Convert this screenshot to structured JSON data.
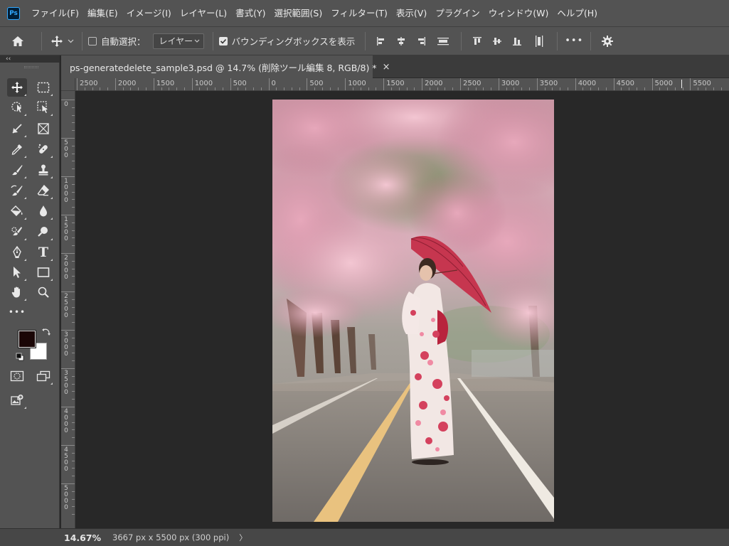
{
  "app": {
    "logo_text": "Ps",
    "menus": [
      "ファイル(F)",
      "編集(E)",
      "イメージ(I)",
      "レイヤー(L)",
      "書式(Y)",
      "選択範囲(S)",
      "フィルター(T)",
      "表示(V)",
      "プラグイン",
      "ウィンドウ(W)",
      "ヘルプ(H)"
    ]
  },
  "options": {
    "auto_select_label": "自動選択：",
    "auto_select_checked": false,
    "layer_select_value": "レイヤー",
    "bounding_box_label": "バウンディングボックスを表示",
    "bounding_box_checked": true,
    "more_label": "•••"
  },
  "panel": {
    "collapse_label": "‹‹"
  },
  "document": {
    "tab_title": "ps-generatedelete_sample3.psd @ 14.7% (削除ツール編集 8, RGB/8) *",
    "close_glyph": "×"
  },
  "rulers": {
    "horizontal_labels": [
      "2500",
      "2000",
      "1500",
      "1000",
      "500",
      "0",
      "500",
      "1000",
      "1500",
      "2000",
      "2500",
      "3000",
      "3500",
      "4000",
      "4500",
      "5000",
      "5500"
    ],
    "vertical_labels": [
      "0",
      "500",
      "1000",
      "1500",
      "2000",
      "2500",
      "3000",
      "3500",
      "4000",
      "4500",
      "5000"
    ]
  },
  "tools": [
    {
      "name": "move-tool",
      "icon": "move-icon",
      "active": true
    },
    {
      "name": "rectangular-marquee-tool",
      "icon": "marquee-icon"
    },
    {
      "name": "object-selection-tool",
      "icon": "object-selection-icon"
    },
    {
      "name": "select-subject-tool",
      "icon": "select-subject-icon"
    },
    {
      "name": "crop-tool",
      "icon": "crop-icon"
    },
    {
      "name": "frame-tool",
      "icon": "frame-icon"
    },
    {
      "name": "eyedropper-tool",
      "icon": "eyedropper-icon"
    },
    {
      "name": "healing-brush-tool",
      "icon": "bandage-icon"
    },
    {
      "name": "brush-tool",
      "icon": "brush-icon"
    },
    {
      "name": "clone-stamp-tool",
      "icon": "stamp-icon"
    },
    {
      "name": "history-brush-tool",
      "icon": "history-brush-icon"
    },
    {
      "name": "eraser-tool",
      "icon": "eraser-icon"
    },
    {
      "name": "paint-bucket-tool",
      "icon": "paint-bucket-icon"
    },
    {
      "name": "blur-tool",
      "icon": "drop-icon"
    },
    {
      "name": "remove-tool",
      "icon": "remove-brush-icon"
    },
    {
      "name": "dodge-tool",
      "icon": "dodge-icon"
    },
    {
      "name": "pen-tool",
      "icon": "pen-icon"
    },
    {
      "name": "type-tool",
      "icon": "type-icon",
      "glyph": "T"
    },
    {
      "name": "path-selection-tool",
      "icon": "arrow-pointer-icon"
    },
    {
      "name": "rectangle-tool",
      "icon": "rectangle-icon"
    },
    {
      "name": "hand-tool",
      "icon": "hand-icon"
    },
    {
      "name": "zoom-tool",
      "icon": "magnifier-icon"
    },
    {
      "name": "edit-toolbar",
      "icon": "more-icon",
      "glyph": "•••"
    }
  ],
  "colors": {
    "foreground": "#1a0606",
    "background": "#ffffff",
    "ui_dark": "#282828",
    "ui_panel": "#535353",
    "accent_ps": "#31a8ff"
  },
  "status": {
    "zoom": "14.67%",
    "doc_info": "3667 px x 5500 px (300 ppi)",
    "arrow": "〉"
  }
}
